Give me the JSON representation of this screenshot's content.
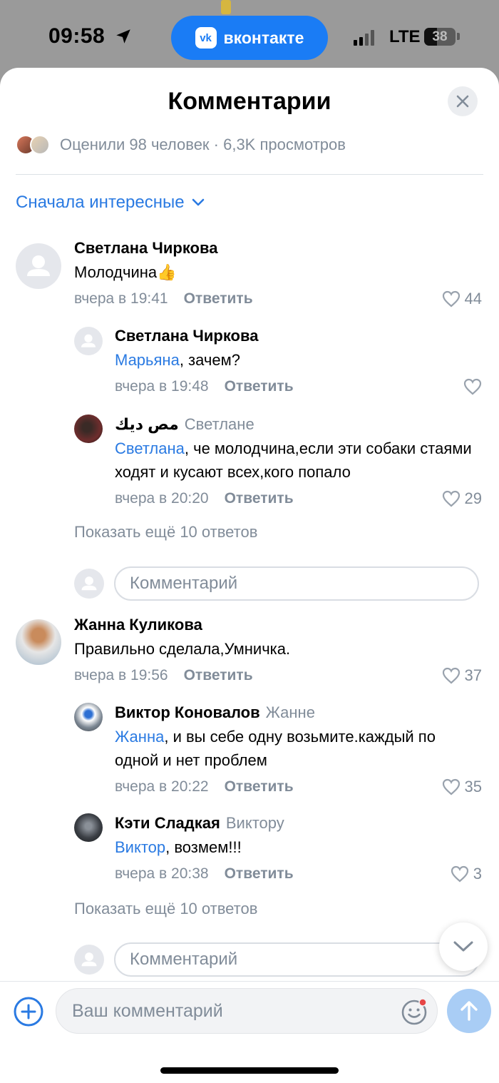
{
  "status_bar": {
    "time": "09:58",
    "app_pill": "вконтакте",
    "app_logo": "vk",
    "network": "LTE",
    "battery": "38"
  },
  "sheet": {
    "title": "Комментарии",
    "stats": "Оценили 98 человек · 6,3K просмотров",
    "sort_label": "Сначала интересные",
    "reply_label": "Ответить",
    "show_more": "Показать ещё 10 ответов",
    "comment_placeholder": "Комментарий"
  },
  "threads": [
    {
      "author": "Светлана Чиркова",
      "text": "Молодчина👍",
      "time": "вчера в 19:41",
      "likes": "44",
      "replies": [
        {
          "author": "Светлана Чиркова",
          "reply_to": "",
          "mention": "Марьяна",
          "text": ", зачем?",
          "time": "вчера в 19:48",
          "likes": ""
        },
        {
          "author": "مص ديك",
          "reply_to": "Светлане",
          "mention": "Светлана",
          "text": ", че молодчина,если эти собаки стаями ходят и кусают всех,кого попало",
          "time": "вчера в 20:20",
          "likes": "29"
        }
      ]
    },
    {
      "author": "Жанна Куликова",
      "text": "Правильно сделала,Умничка.",
      "time": "вчера в 19:56",
      "likes": "37",
      "replies": [
        {
          "author": "Виктор Коновалов",
          "reply_to": "Жанне",
          "mention": "Жанна",
          "text": ", и вы себе одну возьмите.каждый по одной и нет проблем",
          "time": "вчера в 20:22",
          "likes": "35"
        },
        {
          "author": "Кэти Сладкая",
          "reply_to": "Виктору",
          "mention": "Виктор",
          "text": ", возмем!!!",
          "time": "вчера в 20:38",
          "likes": "3"
        }
      ]
    }
  ],
  "composer": {
    "placeholder": "Ваш комментарий"
  },
  "colors": {
    "accent": "#2a7ae2",
    "secondary_text": "#818c99",
    "vk_blue": "#1a7cf5",
    "send_disabled": "#a9cdf5"
  }
}
